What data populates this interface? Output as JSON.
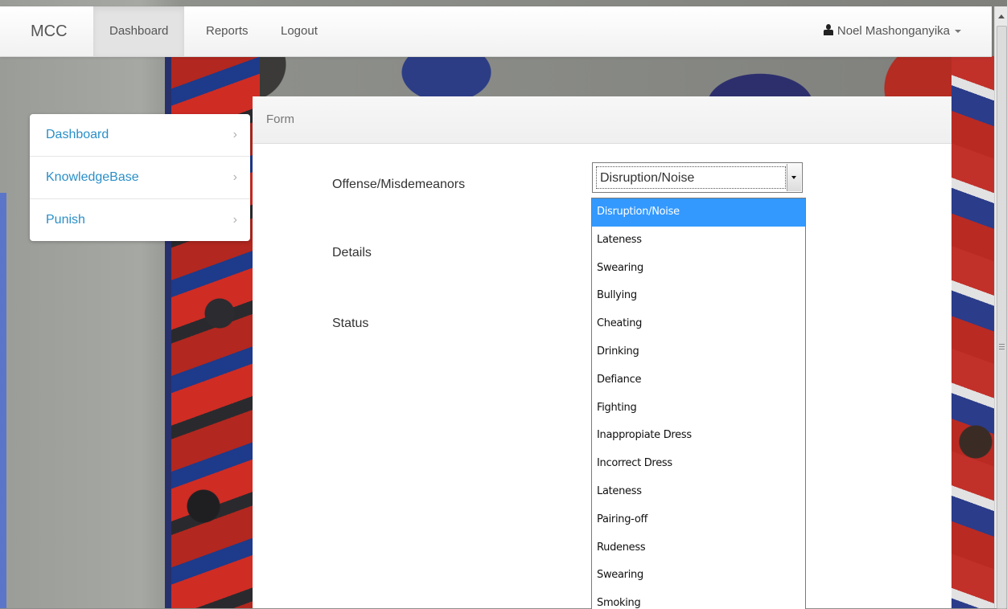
{
  "navbar": {
    "brand": "MCC",
    "items": [
      {
        "label": "Dashboard",
        "active": true
      },
      {
        "label": "Reports",
        "active": false
      },
      {
        "label": "Logout",
        "active": false
      }
    ],
    "user": "Noel Mashonganyika"
  },
  "sidebar": {
    "items": [
      {
        "label": "Dashboard"
      },
      {
        "label": "KnowledgeBase"
      },
      {
        "label": "Punish"
      }
    ]
  },
  "panel": {
    "title": "Form",
    "fields": {
      "offense_label": "Offense/Misdemeanors",
      "details_label": "Details",
      "status_label": "Status"
    },
    "offense_select": {
      "value": "Disruption/Noise",
      "options": [
        "Disruption/Noise",
        "Lateness",
        "Swearing",
        "Bullying",
        "Cheating",
        "Drinking",
        "Defiance",
        "Fighting",
        "Inappropiate Dress",
        "Incorrect Dress",
        "Lateness",
        "Pairing-off",
        "Rudeness",
        "Swearing",
        "Smoking"
      ]
    }
  },
  "colors": {
    "link": "#2a8fc8",
    "selected_option": "#3399ff"
  }
}
